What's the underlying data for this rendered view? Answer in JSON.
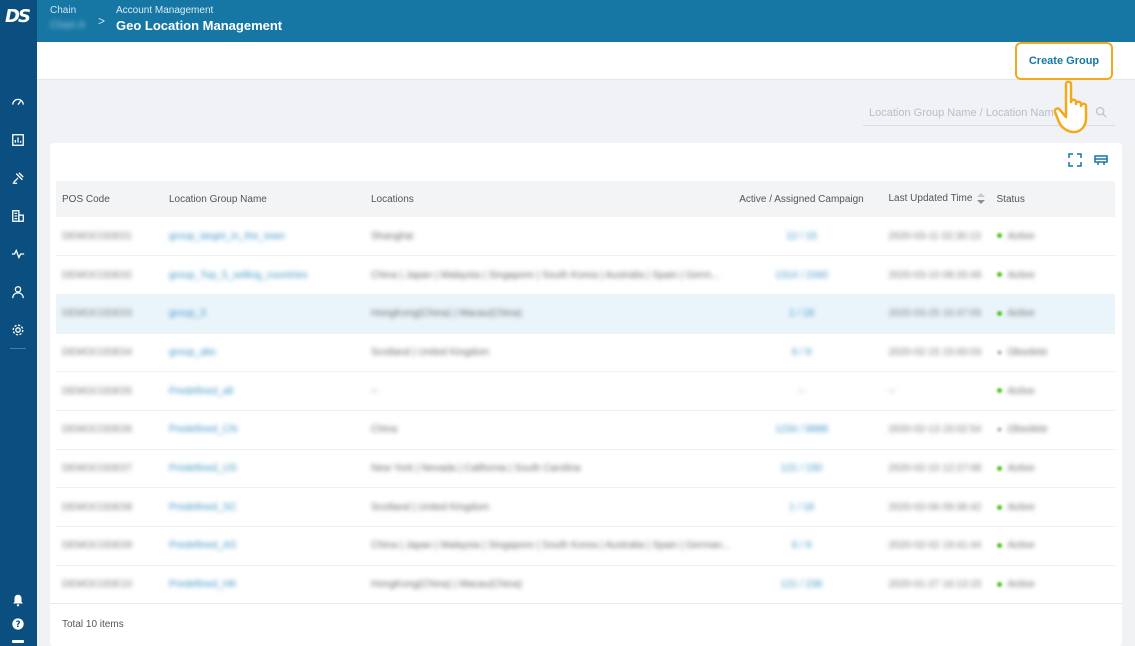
{
  "header": {
    "chain_label": "Chain",
    "chain_value": "Chain A",
    "separator": ">",
    "parent": "Account Management",
    "title": "Geo Location Management"
  },
  "sidebar": {
    "logo": "DS",
    "icons": [
      "dashboard-icon",
      "report-icon",
      "campaign-icon",
      "building-icon",
      "activity-icon",
      "user-icon",
      "settings-icon",
      "bell-icon",
      "help-icon"
    ]
  },
  "toolbar": {
    "create_label": "Create Group",
    "accent": "#f2a91b"
  },
  "search": {
    "placeholder": "Location Group Name / Location Name"
  },
  "table": {
    "columns": [
      "POS Code",
      "Location Group Name",
      "Locations",
      "Active / Assigned Campaign",
      "Last Updated Time",
      "Status"
    ],
    "rows": [
      {
        "code": "DEMOCODE01",
        "group": "group_target_in_the_town",
        "locations": "Shanghai",
        "campaign": "12 / 15",
        "time": "2020-03-11 02:30:13",
        "status": "Active",
        "status_color": "#52c41a"
      },
      {
        "code": "DEMOCODE02",
        "group": "group_Top_5_selling_countries",
        "locations": "China | Japan | Malaysia | Singapore | South Korea | Australia | Spain | Germ...",
        "campaign": "1314 / 2340",
        "time": "2020-03-10 08:20:49",
        "status": "Active",
        "status_color": "#52c41a"
      },
      {
        "code": "DEMOCODE03",
        "group": "group_3",
        "locations": "HongKong(China) | Macau(China)",
        "campaign": "1 / 18",
        "time": "2020-03-25 16:47:05",
        "status": "Active",
        "status_color": "#52c41a"
      },
      {
        "code": "DEMOCODE04",
        "group": "group_abc",
        "locations": "Scotland | United Kingdom",
        "campaign": "6 / 9",
        "time": "2020-02-15 15:00:03",
        "status": "Obsolete",
        "status_color": "#c0c4c8"
      },
      {
        "code": "DEMOCODE05",
        "group": "Predefined_all",
        "locations": "--",
        "campaign": "--",
        "time": "--",
        "status": "Active",
        "status_color": "#52c41a"
      },
      {
        "code": "DEMOCODE06",
        "group": "Predefined_CN",
        "locations": "China",
        "campaign": "1234 / 8888",
        "time": "2020-02-13 15:02:54",
        "status": "Obsolete",
        "status_color": "#c0c4c8"
      },
      {
        "code": "DEMOCODE07",
        "group": "Predefined_US",
        "locations": "New York | Nevada | California | South Carolina",
        "campaign": "121 / 150",
        "time": "2020-02-10 12:27:08",
        "status": "Active",
        "status_color": "#52c41a"
      },
      {
        "code": "DEMOCODE08",
        "group": "Predefined_SC",
        "locations": "Scotland | United Kingdom",
        "campaign": "1 / 18",
        "time": "2020-02-06 09:36:42",
        "status": "Active",
        "status_color": "#52c41a"
      },
      {
        "code": "DEMOCODE09",
        "group": "Predefined_AS",
        "locations": "China | Japan | Malaysia | Singapore | South Korea | Australia | Spain | German...",
        "campaign": "6 / 9",
        "time": "2020-02-02 19:41:44",
        "status": "Active",
        "status_color": "#52c41a"
      },
      {
        "code": "DEMOCODE10",
        "group": "Predefined_HK",
        "locations": "HongKong(China) | Macau(China)",
        "campaign": "121 / 236",
        "time": "2020-01-27 16:13:15",
        "status": "Active",
        "status_color": "#52c41a"
      }
    ]
  },
  "footer": {
    "total": "Total 10 items"
  },
  "colors": {
    "header_bg": "#1777a4",
    "sidebar_bg": "#0b4f80",
    "link": "#1777a4"
  }
}
